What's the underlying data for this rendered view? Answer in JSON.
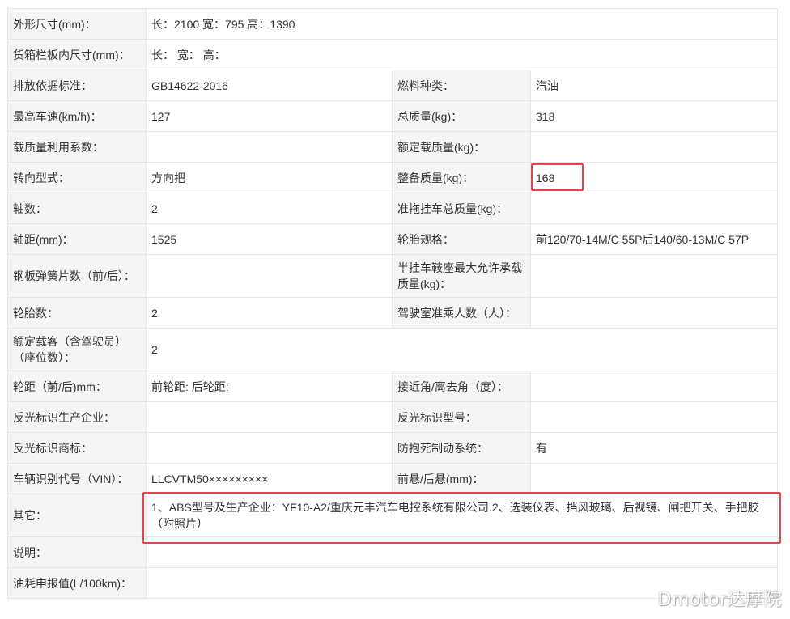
{
  "rows": {
    "dimensions": {
      "label": "外形尺寸(mm)：",
      "value": "长：2100 宽：795 高：1390"
    },
    "cargo_box": {
      "label": "货箱栏板内尺寸(mm)：",
      "value": "长：  宽：  高："
    },
    "emission": {
      "label": "排放依据标准：",
      "value": "GB14622-2016",
      "label2": "燃料种类：",
      "value2": "汽油"
    },
    "speed": {
      "label": "最高车速(km/h)：",
      "value": "127",
      "label2": "总质量(kg)：",
      "value2": "318"
    },
    "load_factor": {
      "label": "载质量利用系数：",
      "value": "",
      "label2": "额定载质量(kg)：",
      "value2": ""
    },
    "steering": {
      "label": "转向型式：",
      "value": "方向把",
      "label2": "整备质量(kg)：",
      "value2": "168"
    },
    "axles": {
      "label": "轴数：",
      "value": "2",
      "label2": "准拖挂车总质量(kg)：",
      "value2": ""
    },
    "wheelbase": {
      "label": "轴距(mm)：",
      "value": "1525",
      "label2": "轮胎规格：",
      "value2": "前120/70-14M/C 55P后140/60-13M/C 57P"
    },
    "springs": {
      "label": "钢板弹簧片数（前/后）：",
      "value": "",
      "label2": "半挂车鞍座最大允许承载质量(kg)：",
      "value2": ""
    },
    "tires": {
      "label": "轮胎数：",
      "value": "2",
      "label2": "驾驶室准乘人数（人）：",
      "value2": ""
    },
    "seats": {
      "label": "额定载客（含驾驶员）（座位数）：",
      "value": "2"
    },
    "track": {
      "label": "轮距（前/后)mm：",
      "value": "前轮距: 后轮距:",
      "label2": "接近角/离去角（度）：",
      "value2": ""
    },
    "reflector_maker": {
      "label": "反光标识生产企业：",
      "value": "",
      "label2": "反光标识型号：",
      "value2": ""
    },
    "reflector_brand": {
      "label": "反光标识商标：",
      "value": "",
      "label2": "防抱死制动系统：",
      "value2": "有"
    },
    "vin": {
      "label": "车辆识别代号（VIN）：",
      "value": "LLCVTM50×××××××××",
      "label2": "前悬/后悬(mm)：",
      "value2": ""
    },
    "other": {
      "label": "其它：",
      "value": "1、ABS型号及生产企业：YF10-A2/重庆元丰汽车电控系统有限公司.2、选装仪表、挡风玻璃、后视镜、闸把开关、手把胶（附照片）"
    },
    "notes": {
      "label": "说明：",
      "value": ""
    },
    "fuel": {
      "label": "油耗申报值(L/100km)：",
      "value": ""
    }
  },
  "watermark": "Dmotor达摩院",
  "colors": {
    "highlight": "#e0464c",
    "key_bg": "#f5f5f5",
    "border": "#e6e6e6"
  }
}
